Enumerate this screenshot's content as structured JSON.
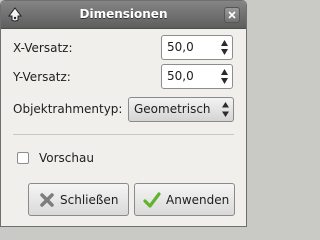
{
  "window": {
    "title": "Dimensionen"
  },
  "fields": {
    "x_offset": {
      "label": "X-Versatz:",
      "value": "50,0"
    },
    "y_offset": {
      "label": "Y-Versatz:",
      "value": "50,0"
    },
    "bbox_type": {
      "label": "Objektrahmentyp:",
      "selected": "Geometrisch"
    }
  },
  "preview": {
    "label": "Vorschau",
    "checked": false
  },
  "buttons": {
    "close_label": "Schließen",
    "apply_label": "Anwenden"
  },
  "colors": {
    "titlebar": "#6e6e6e",
    "apply_check": "#5fb42a",
    "close_x": "#8a8a8a"
  },
  "icons": {
    "app": "inkscape-icon",
    "close": "close-icon",
    "close_button": "x-icon",
    "apply_button": "checkmark-icon"
  }
}
